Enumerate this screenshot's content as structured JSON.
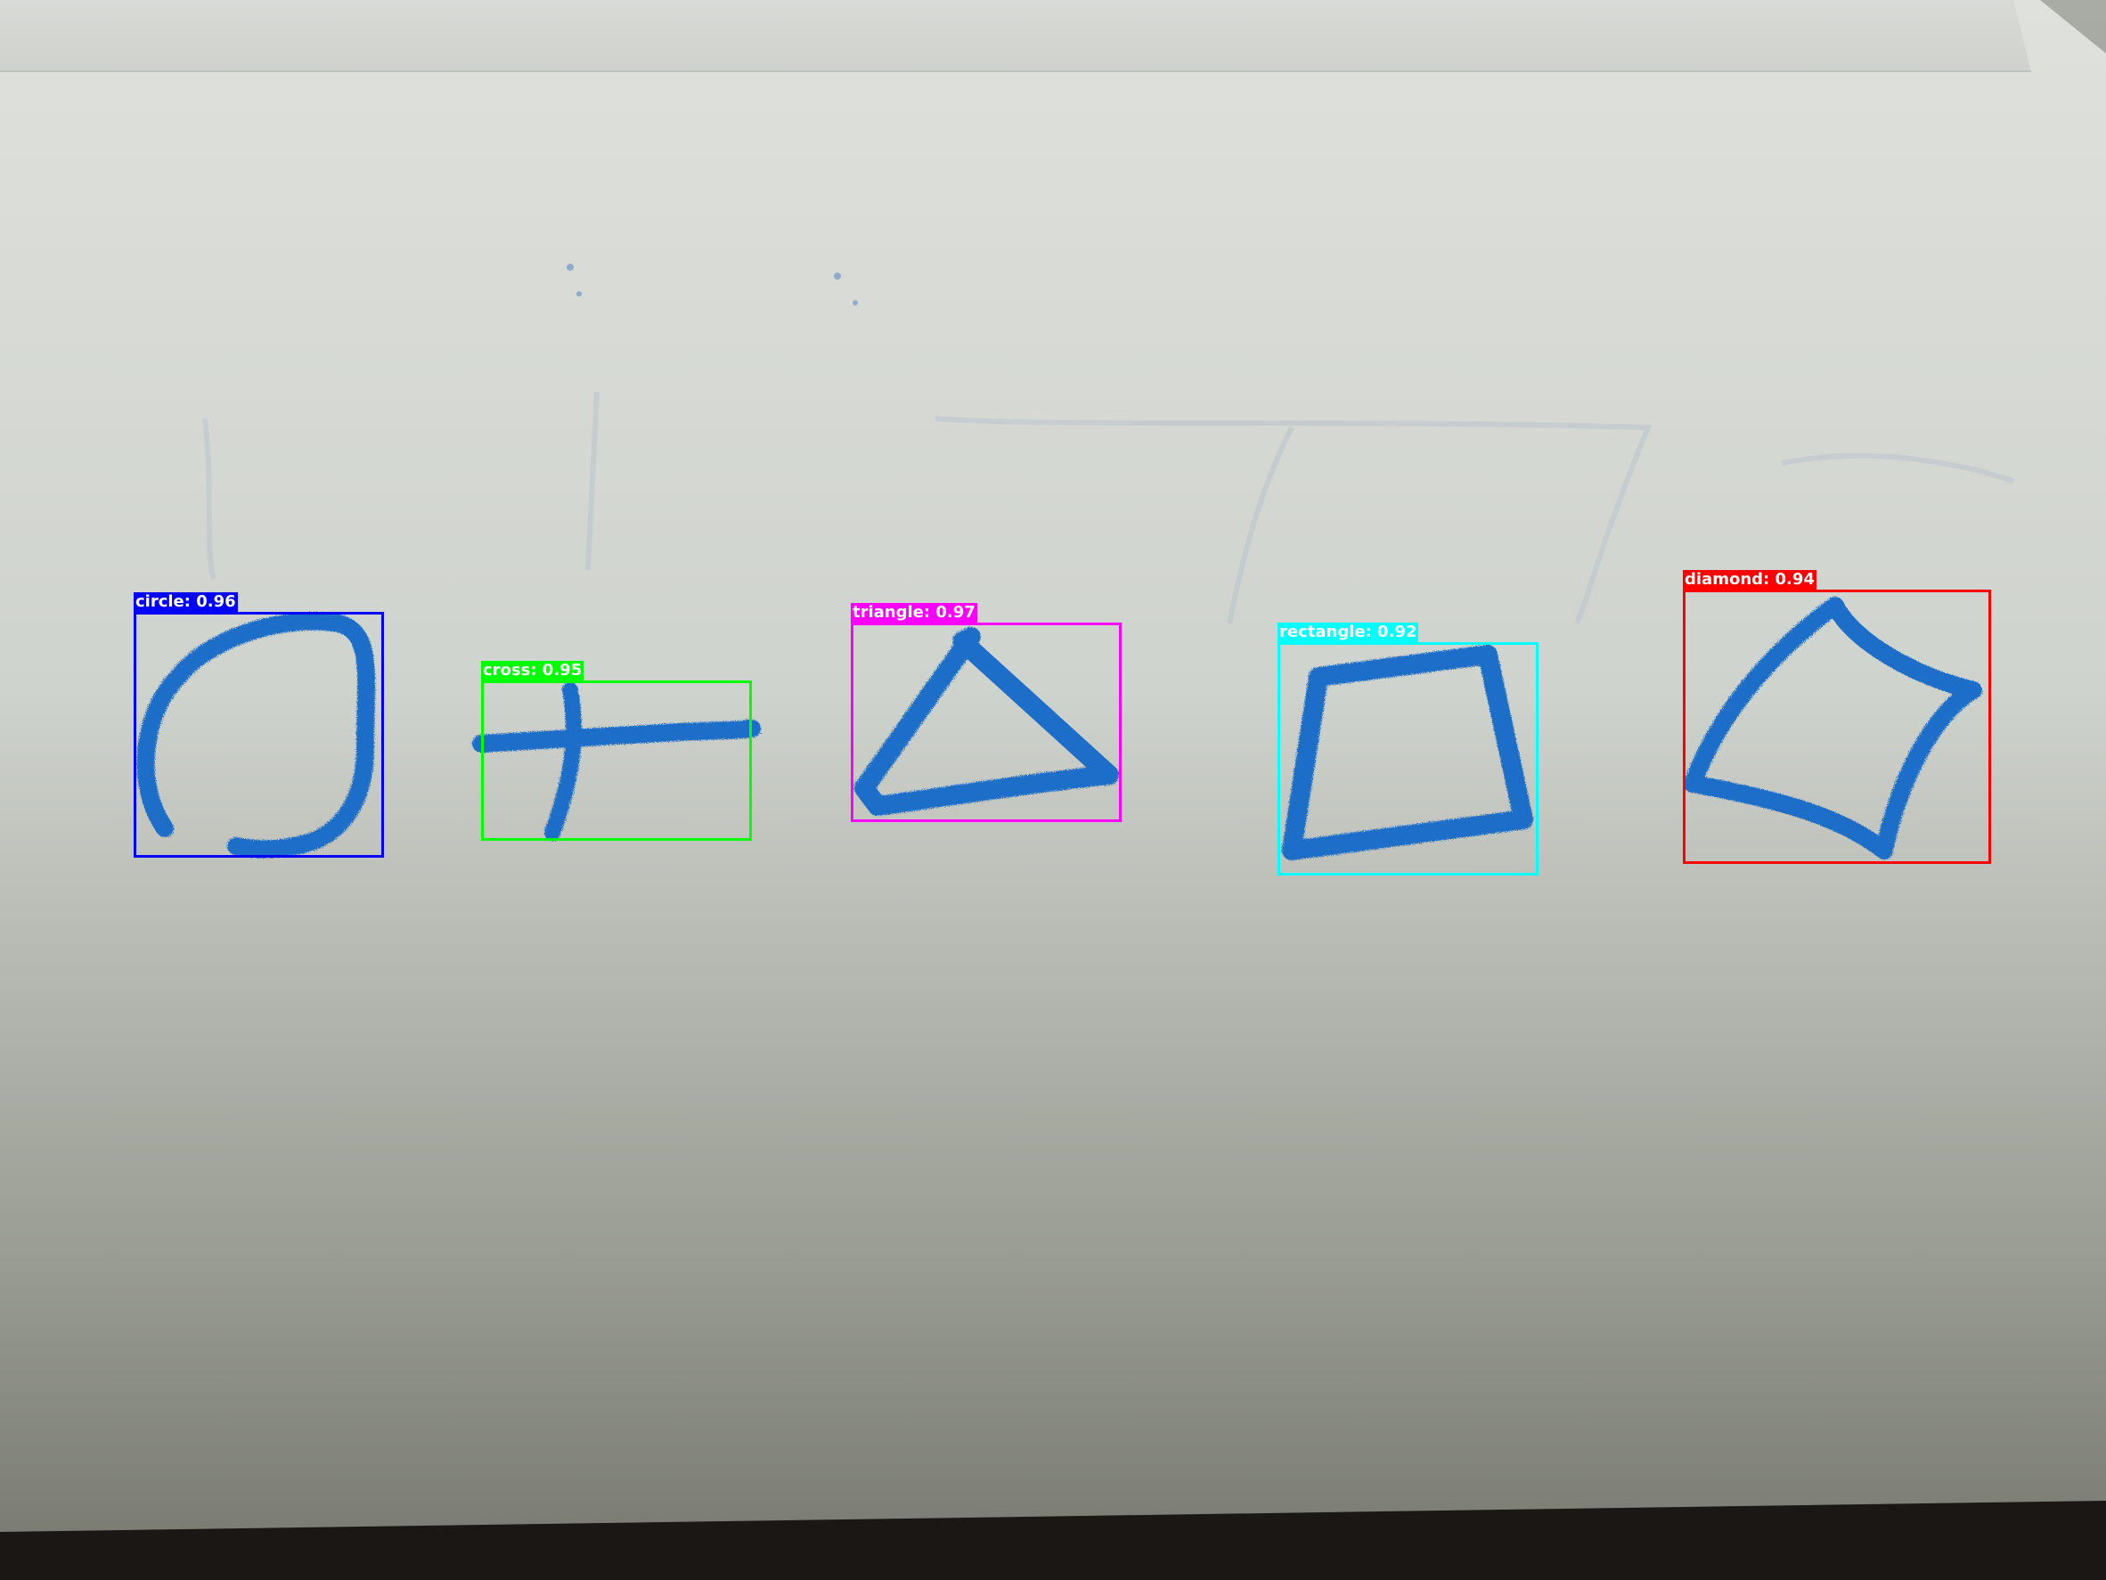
{
  "detections": [
    {
      "label": "circle: 0.96",
      "color": "#0000ff",
      "text_color": "#ffffff"
    },
    {
      "label": "cross: 0.95",
      "color": "#00ff00",
      "text_color": "#ffffff"
    },
    {
      "label": "triangle: 0.97",
      "color": "#ff00ff",
      "text_color": "#ffffff"
    },
    {
      "label": "rectangle: 0.92",
      "color": "#00ffff",
      "text_color": "#ffffff"
    },
    {
      "label": "diamond: 0.94",
      "color": "#ff0000",
      "text_color": "#ffffff"
    }
  ],
  "colors": {
    "crayon": "#1e6ec8",
    "paper": "#d9dcd6",
    "table": "#1a1714"
  }
}
